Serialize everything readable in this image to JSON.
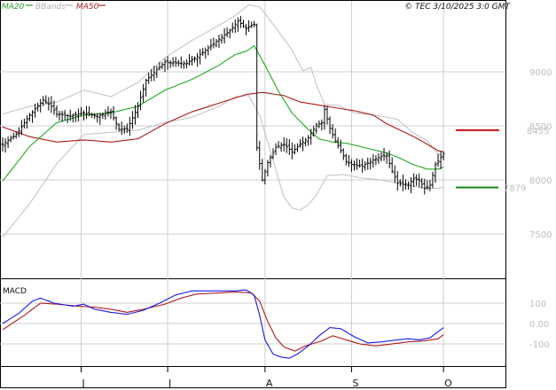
{
  "header": {
    "legend": [
      {
        "label": "MA20",
        "color": "#2ca02c"
      },
      {
        "label": "BBands",
        "color": "#b0b0b0"
      },
      {
        "label": "MA50",
        "color": "#b22222"
      }
    ],
    "timestamp": "© TEC 3/10/2025 3:0 GMT"
  },
  "colors": {
    "price": "#000000",
    "ma20": "#1faa1f",
    "ma50": "#b01818",
    "bbands": "#c0c0c0",
    "grid": "#cfcfcf",
    "resistance": "#cc1111",
    "support": "#118811",
    "macd": "#1a1ae6",
    "signal": "#b01818",
    "text_gray": "#bdbdbd"
  },
  "chart_data": [
    {
      "type": "line",
      "name": "price",
      "y_ticks": [
        "9000",
        "8500",
        "8000",
        "7500"
      ],
      "ylim": [
        7200,
        9800
      ],
      "x_ticks": [
        {
          "label": "J",
          "index": 29
        },
        {
          "label": "J",
          "index": 61
        },
        {
          "label": "A",
          "index": 97
        },
        {
          "label": "S",
          "index": 129
        },
        {
          "label": "O",
          "index": 163
        }
      ],
      "levels": [
        {
          "label": "8455",
          "value": 8460,
          "kind": "resistance"
        },
        {
          "label": "7879",
          "value": 7930,
          "kind": "support"
        }
      ],
      "price_anchors": [
        [
          0,
          8330
        ],
        [
          5,
          8420
        ],
        [
          10,
          8600
        ],
        [
          15,
          8740
        ],
        [
          18,
          8680
        ],
        [
          20,
          8610
        ],
        [
          25,
          8590
        ],
        [
          30,
          8620
        ],
        [
          35,
          8590
        ],
        [
          40,
          8630
        ],
        [
          43,
          8470
        ],
        [
          46,
          8470
        ],
        [
          50,
          8680
        ],
        [
          53,
          8920
        ],
        [
          57,
          9020
        ],
        [
          60,
          9090
        ],
        [
          64,
          9080
        ],
        [
          68,
          9080
        ],
        [
          72,
          9140
        ],
        [
          76,
          9220
        ],
        [
          80,
          9300
        ],
        [
          84,
          9380
        ],
        [
          87,
          9470
        ],
        [
          90,
          9400
        ],
        [
          93,
          9440
        ],
        [
          94,
          8300
        ],
        [
          96,
          8000
        ],
        [
          98,
          8160
        ],
        [
          101,
          8300
        ],
        [
          104,
          8330
        ],
        [
          107,
          8260
        ],
        [
          110,
          8330
        ],
        [
          113,
          8390
        ],
        [
          116,
          8510
        ],
        [
          118,
          8530
        ],
        [
          119,
          8650
        ],
        [
          121,
          8480
        ],
        [
          123,
          8360
        ],
        [
          125,
          8270
        ],
        [
          127,
          8170
        ],
        [
          130,
          8130
        ],
        [
          133,
          8130
        ],
        [
          136,
          8170
        ],
        [
          139,
          8210
        ],
        [
          142,
          8230
        ],
        [
          144,
          8080
        ],
        [
          146,
          7970
        ],
        [
          150,
          7960
        ],
        [
          152,
          8010
        ],
        [
          154,
          8000
        ],
        [
          156,
          7920
        ],
        [
          158,
          7950
        ],
        [
          160,
          8140
        ],
        [
          163,
          8240
        ]
      ],
      "ma20_anchors": [
        [
          0,
          7990
        ],
        [
          10,
          8310
        ],
        [
          20,
          8530
        ],
        [
          30,
          8600
        ],
        [
          40,
          8620
        ],
        [
          50,
          8680
        ],
        [
          60,
          8830
        ],
        [
          70,
          8930
        ],
        [
          80,
          9060
        ],
        [
          86,
          9160
        ],
        [
          90,
          9190
        ],
        [
          93,
          9240
        ],
        [
          97,
          9060
        ],
        [
          102,
          8820
        ],
        [
          107,
          8620
        ],
        [
          112,
          8490
        ],
        [
          117,
          8380
        ],
        [
          122,
          8350
        ],
        [
          127,
          8340
        ],
        [
          132,
          8310
        ],
        [
          137,
          8280
        ],
        [
          142,
          8250
        ],
        [
          147,
          8200
        ],
        [
          152,
          8140
        ],
        [
          157,
          8100
        ],
        [
          161,
          8100
        ],
        [
          163,
          8120
        ]
      ],
      "ma50_anchors": [
        [
          0,
          8490
        ],
        [
          10,
          8400
        ],
        [
          20,
          8350
        ],
        [
          30,
          8370
        ],
        [
          40,
          8350
        ],
        [
          50,
          8380
        ],
        [
          60,
          8520
        ],
        [
          70,
          8630
        ],
        [
          80,
          8710
        ],
        [
          90,
          8790
        ],
        [
          96,
          8810
        ],
        [
          104,
          8780
        ],
        [
          110,
          8720
        ],
        [
          120,
          8680
        ],
        [
          130,
          8640
        ],
        [
          137,
          8600
        ],
        [
          142,
          8520
        ],
        [
          147,
          8460
        ],
        [
          152,
          8400
        ],
        [
          157,
          8330
        ],
        [
          161,
          8270
        ],
        [
          163,
          8260
        ]
      ],
      "bb_upper_anchors": [
        [
          0,
          8610
        ],
        [
          10,
          8680
        ],
        [
          20,
          8720
        ],
        [
          30,
          8830
        ],
        [
          40,
          8770
        ],
        [
          50,
          8900
        ],
        [
          60,
          9130
        ],
        [
          70,
          9290
        ],
        [
          80,
          9430
        ],
        [
          86,
          9520
        ],
        [
          91,
          9620
        ],
        [
          95,
          9600
        ],
        [
          100,
          9440
        ],
        [
          107,
          9200
        ],
        [
          111,
          9010
        ],
        [
          114,
          9040
        ],
        [
          116,
          8880
        ],
        [
          119,
          8700
        ],
        [
          124,
          8690
        ],
        [
          130,
          8620
        ],
        [
          140,
          8590
        ],
        [
          146,
          8560
        ],
        [
          151,
          8450
        ],
        [
          157,
          8360
        ],
        [
          161,
          8240
        ],
        [
          163,
          8220
        ]
      ],
      "bb_lower_anchors": [
        [
          0,
          7470
        ],
        [
          10,
          7780
        ],
        [
          20,
          8150
        ],
        [
          30,
          8420
        ],
        [
          40,
          8440
        ],
        [
          50,
          8460
        ],
        [
          60,
          8530
        ],
        [
          70,
          8580
        ],
        [
          80,
          8680
        ],
        [
          86,
          8770
        ],
        [
          91,
          8780
        ],
        [
          95,
          8600
        ],
        [
          100,
          8180
        ],
        [
          104,
          7840
        ],
        [
          107,
          7740
        ],
        [
          110,
          7720
        ],
        [
          113,
          7770
        ],
        [
          116,
          7860
        ],
        [
          120,
          8040
        ],
        [
          126,
          8050
        ],
        [
          132,
          8020
        ],
        [
          140,
          8000
        ],
        [
          148,
          7960
        ],
        [
          154,
          7930
        ],
        [
          160,
          7920
        ],
        [
          163,
          7930
        ]
      ]
    },
    {
      "type": "line",
      "name": "MACD",
      "title": "MACD",
      "y_ticks": [
        "100",
        "0.00",
        "-100"
      ],
      "ylim": [
        -200,
        180
      ],
      "macd_anchors": [
        [
          0,
          0
        ],
        [
          6,
          50
        ],
        [
          11,
          110
        ],
        [
          14,
          125
        ],
        [
          19,
          100
        ],
        [
          26,
          85
        ],
        [
          30,
          95
        ],
        [
          34,
          70
        ],
        [
          40,
          55
        ],
        [
          46,
          45
        ],
        [
          52,
          65
        ],
        [
          58,
          100
        ],
        [
          64,
          140
        ],
        [
          70,
          160
        ],
        [
          80,
          160
        ],
        [
          86,
          160
        ],
        [
          90,
          165
        ],
        [
          93,
          140
        ],
        [
          95,
          40
        ],
        [
          97,
          -80
        ],
        [
          100,
          -150
        ],
        [
          103,
          -165
        ],
        [
          106,
          -170
        ],
        [
          109,
          -150
        ],
        [
          113,
          -110
        ],
        [
          117,
          -60
        ],
        [
          121,
          -20
        ],
        [
          125,
          -25
        ],
        [
          130,
          -65
        ],
        [
          135,
          -95
        ],
        [
          140,
          -90
        ],
        [
          146,
          -80
        ],
        [
          150,
          -75
        ],
        [
          154,
          -80
        ],
        [
          158,
          -70
        ],
        [
          161,
          -40
        ],
        [
          163,
          -20
        ]
      ],
      "signal_anchors": [
        [
          0,
          -30
        ],
        [
          8,
          40
        ],
        [
          14,
          100
        ],
        [
          20,
          95
        ],
        [
          28,
          85
        ],
        [
          34,
          80
        ],
        [
          40,
          70
        ],
        [
          46,
          55
        ],
        [
          52,
          70
        ],
        [
          60,
          95
        ],
        [
          66,
          125
        ],
        [
          72,
          145
        ],
        [
          80,
          150
        ],
        [
          86,
          155
        ],
        [
          92,
          150
        ],
        [
          95,
          110
        ],
        [
          98,
          10
        ],
        [
          101,
          -70
        ],
        [
          104,
          -115
        ],
        [
          108,
          -135
        ],
        [
          112,
          -110
        ],
        [
          118,
          -85
        ],
        [
          122,
          -60
        ],
        [
          127,
          -80
        ],
        [
          132,
          -100
        ],
        [
          138,
          -110
        ],
        [
          144,
          -100
        ],
        [
          150,
          -90
        ],
        [
          156,
          -85
        ],
        [
          161,
          -75
        ],
        [
          163,
          -55
        ]
      ]
    }
  ]
}
